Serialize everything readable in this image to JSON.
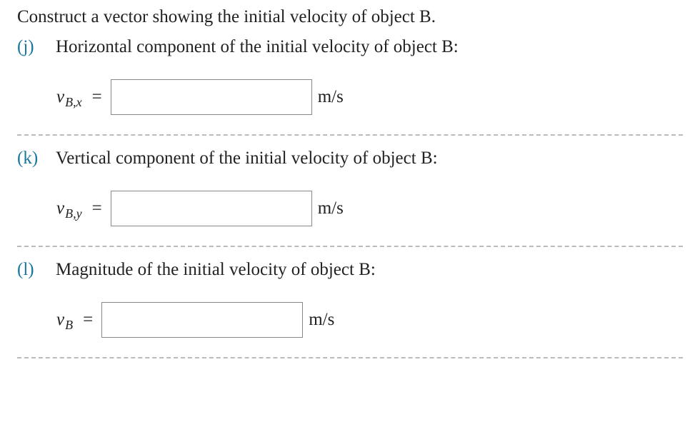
{
  "intro": "Construct a vector showing the initial velocity of object B.",
  "questions": {
    "j": {
      "label": "(j)",
      "text": "Horizontal component of the initial velocity of object B:",
      "variable_main": "v",
      "variable_sub": "B,x",
      "equals": "=",
      "value": "",
      "unit": "m/s"
    },
    "k": {
      "label": "(k)",
      "text": "Vertical component of the initial velocity of object B:",
      "variable_main": "v",
      "variable_sub": "B,y",
      "equals": "=",
      "value": "",
      "unit": "m/s"
    },
    "l": {
      "label": "(l)",
      "text": "Magnitude of the initial velocity of object B:",
      "variable_main": "v",
      "variable_sub": "B",
      "equals": "=",
      "value": "",
      "unit": "m/s"
    }
  }
}
